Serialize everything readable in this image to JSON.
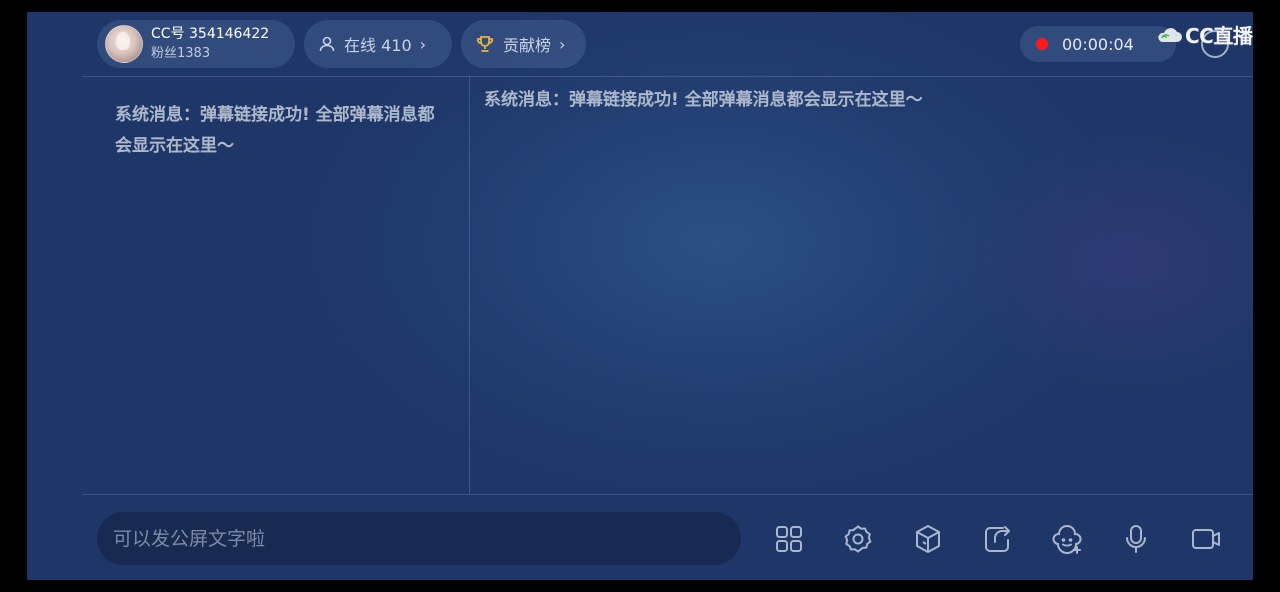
{
  "header": {
    "anchor_id": "CC号 354146422",
    "fans": "粉丝1383",
    "online": "在线 410",
    "contribution": "贡献榜",
    "timer": "00:00:04",
    "logo": "CC直播"
  },
  "messages": {
    "left": "系统消息：弹幕链接成功! 全部弹幕消息都会显示在这里～",
    "right": "系统消息：弹幕链接成功! 全部弹幕消息都会显示在这里～"
  },
  "input": {
    "placeholder": "可以发公屏文字啦"
  },
  "toolbar": {
    "icons": [
      "grid-icon",
      "settings-icon",
      "cube-icon",
      "share-icon",
      "emoji-add-icon",
      "mic-icon",
      "camera-icon"
    ]
  },
  "colors": {
    "background": "#233d70",
    "record": "#ff1a1a",
    "signal": "#3ec43e"
  }
}
